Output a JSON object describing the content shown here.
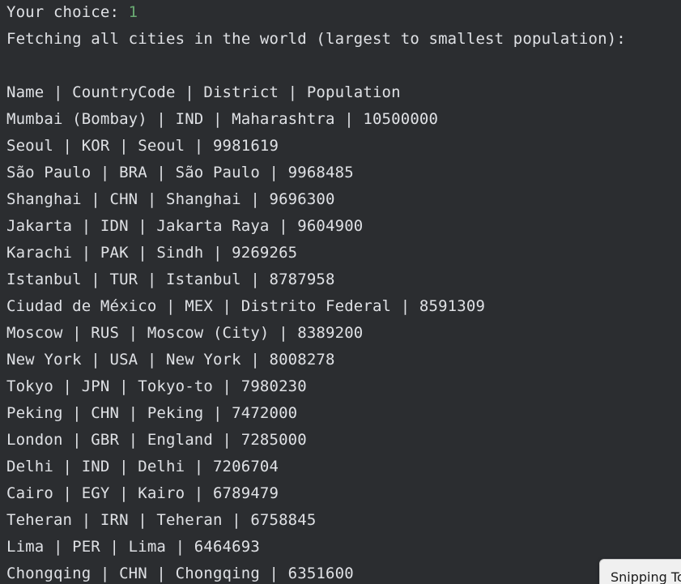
{
  "console": {
    "prompt_label": "Your choice: ",
    "prompt_value": "1",
    "message": "Fetching all cities in the world (largest to smallest population):",
    "header": "Name | CountryCode | District | Population",
    "rows": [
      "Mumbai (Bombay) | IND | Maharashtra | 10500000",
      "Seoul | KOR | Seoul | 9981619",
      "São Paulo | BRA | São Paulo | 9968485",
      "Shanghai | CHN | Shanghai | 9696300",
      "Jakarta | IDN | Jakarta Raya | 9604900",
      "Karachi | PAK | Sindh | 9269265",
      "Istanbul | TUR | Istanbul | 8787958",
      "Ciudad de México | MEX | Distrito Federal | 8591309",
      "Moscow | RUS | Moscow (City) | 8389200",
      "New York | USA | New York | 8008278",
      "Tokyo | JPN | Tokyo-to | 7980230",
      "Peking | CHN | Peking | 7472000",
      "London | GBR | England | 7285000",
      "Delhi | IND | Delhi | 7206704",
      "Cairo | EGY | Kairo | 6789479",
      "Teheran | IRN | Teheran | 6758845",
      "Lima | PER | Lima | 6464693",
      "Chongqing | CHN | Chongqing | 6351600"
    ]
  },
  "tooltip": {
    "label": "Snipping To"
  },
  "colors": {
    "background": "#2b2d30",
    "text": "#dfe1e5",
    "input_value": "#6aab73"
  }
}
